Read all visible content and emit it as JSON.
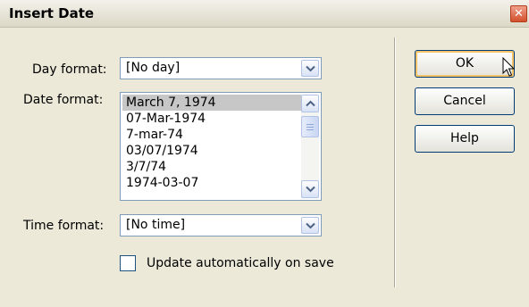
{
  "dialog": {
    "title": "Insert Date"
  },
  "day_format": {
    "label": "Day format:",
    "value": "[No day]"
  },
  "date_format": {
    "label": "Date format:",
    "options": [
      "March 7, 1974",
      "07-Mar-1974",
      "7-mar-74",
      "03/07/1974",
      "3/7/74",
      "1974-03-07"
    ],
    "selected": "March 7, 1974"
  },
  "time_format": {
    "label": "Time format:",
    "value": "[No time]"
  },
  "update_checkbox": {
    "label": "Update automatically on save",
    "checked": false
  },
  "buttons": {
    "ok": "OK",
    "cancel": "Cancel",
    "help": "Help"
  },
  "icons": {
    "close": "close-icon",
    "dropdown": "chevron-down-icon",
    "scroll_up": "chevron-up-icon",
    "scroll_down": "chevron-down-icon",
    "cursor": "mouse-pointer-icon"
  }
}
